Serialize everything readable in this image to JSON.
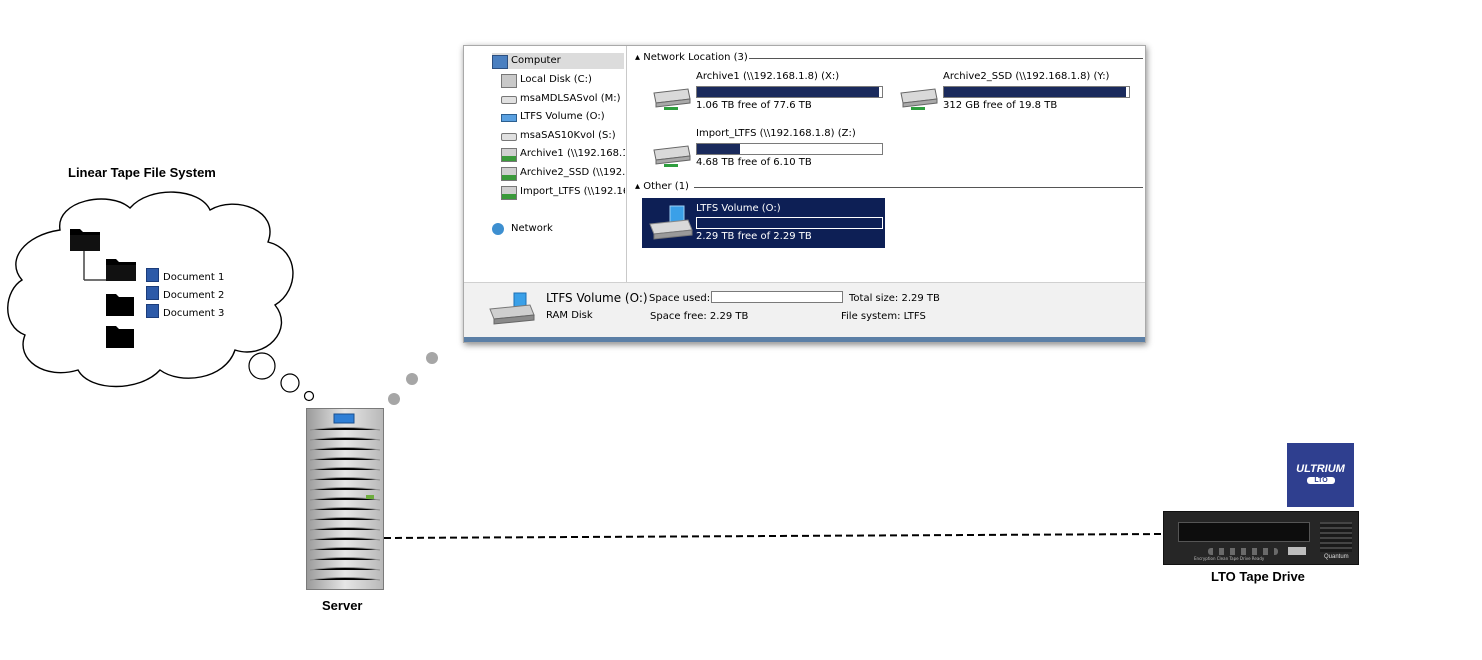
{
  "labels": {
    "ltfs_title": "Linear Tape File System",
    "server": "Server",
    "lto_drive": "LTO Tape Drive"
  },
  "file_tree": {
    "documents": [
      "Document 1",
      "Document 2",
      "Document 3"
    ]
  },
  "explorer": {
    "nav": [
      {
        "label": "Computer",
        "icon": "computer-icon"
      },
      {
        "label": "Local Disk (C:)",
        "icon": "local-disk-icon"
      },
      {
        "label": "msaMDLSASvol (M:)",
        "icon": "drive-icon"
      },
      {
        "label": "LTFS Volume (O:)",
        "icon": "ltfs-drive-icon"
      },
      {
        "label": "msaSAS10Kvol (S:)",
        "icon": "drive-icon"
      },
      {
        "label": "Archive1 (\\\\192.168.1",
        "icon": "network-drive-icon"
      },
      {
        "label": "Archive2_SSD (\\\\192.1",
        "icon": "network-drive-icon"
      },
      {
        "label": "Import_LTFS (\\\\192.16",
        "icon": "network-drive-icon"
      },
      {
        "label": "Network",
        "icon": "network-icon"
      }
    ],
    "groups": {
      "network_location": "Network Location (3)",
      "other": "Other (1)"
    },
    "drives": [
      {
        "name": "Archive1 (\\\\192.168.1.8) (X:)",
        "free": "1.06 TB free of 77.6 TB",
        "used_fraction": 0.986
      },
      {
        "name": "Archive2_SSD (\\\\192.168.1.8) (Y:)",
        "free": "312 GB free of 19.8 TB",
        "used_fraction": 0.984
      },
      {
        "name": "Import_LTFS (\\\\192.168.1.8) (Z:)",
        "free": "4.68 TB free of 6.10 TB",
        "used_fraction": 0.233
      },
      {
        "name": "LTFS Volume (O:)",
        "free": "2.29 TB free of 2.29 TB",
        "used_fraction": 0.0
      }
    ],
    "details": {
      "volume_name": "LTFS Volume (O:)",
      "volume_type": "RAM Disk",
      "space_used_label": "Space used:",
      "space_used_fraction": 0.0,
      "space_free": "Space free: 2.29 TB",
      "total_size": "Total size: 2.29 TB",
      "file_system": "File system: LTFS"
    }
  },
  "badge": {
    "ultrium": "ULTRIUM",
    "lto": "LTO"
  },
  "lto_panel": {
    "brand": "Quantum",
    "indicators": "Encryption Clean Tape Drive Ready"
  },
  "colors": {
    "bar_fill": "#1a2a5c",
    "selection": "#0d1f55",
    "badge": "#2f3f8f"
  }
}
